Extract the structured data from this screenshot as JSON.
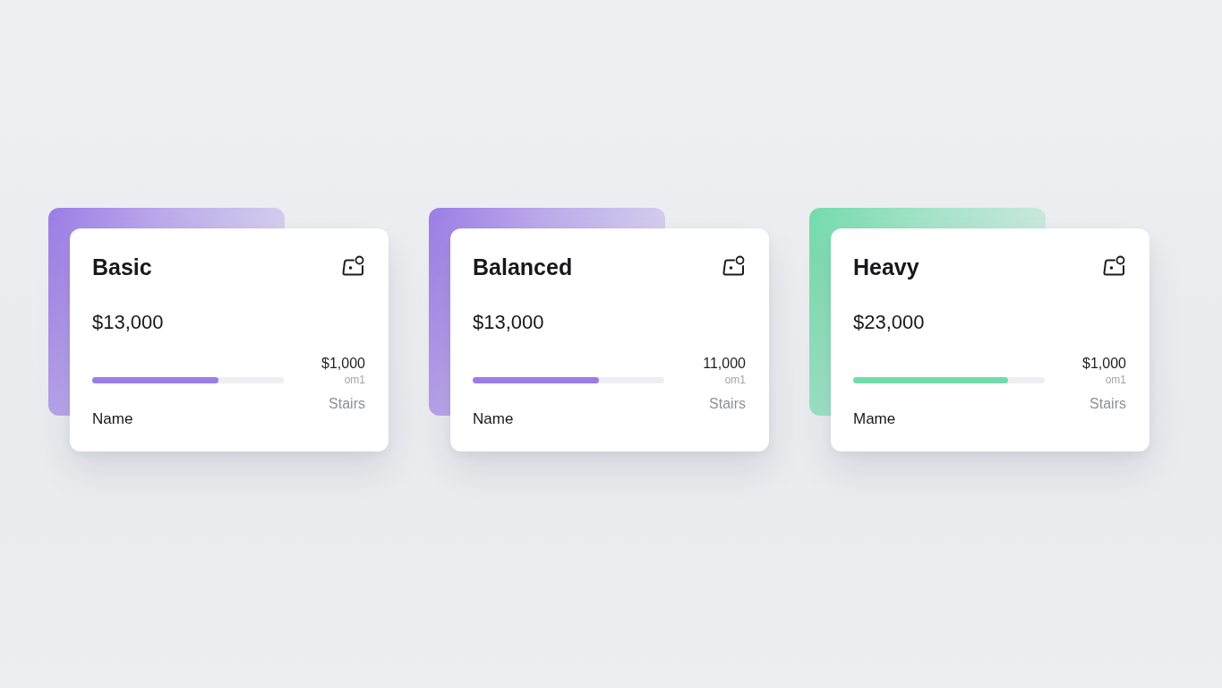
{
  "cards": [
    {
      "title": "Basic",
      "price": "$13,000",
      "level": 0.66,
      "color": "#9b7ce6",
      "name": "Name",
      "amount": "$1,000",
      "unit": "om1",
      "caption": "Stairs"
    },
    {
      "title": "Balanced",
      "price": "$13,000",
      "level": 0.66,
      "color": "#9b7ce6",
      "name": "Name",
      "amount": "11,000",
      "unit": "om1",
      "caption": "Stairs"
    },
    {
      "title": "Heavy",
      "price": "$23,000",
      "level": 0.81,
      "color": "#72dbab",
      "name": "Mame",
      "amount": "$1,000",
      "unit": "om1",
      "caption": "Stairs"
    }
  ]
}
